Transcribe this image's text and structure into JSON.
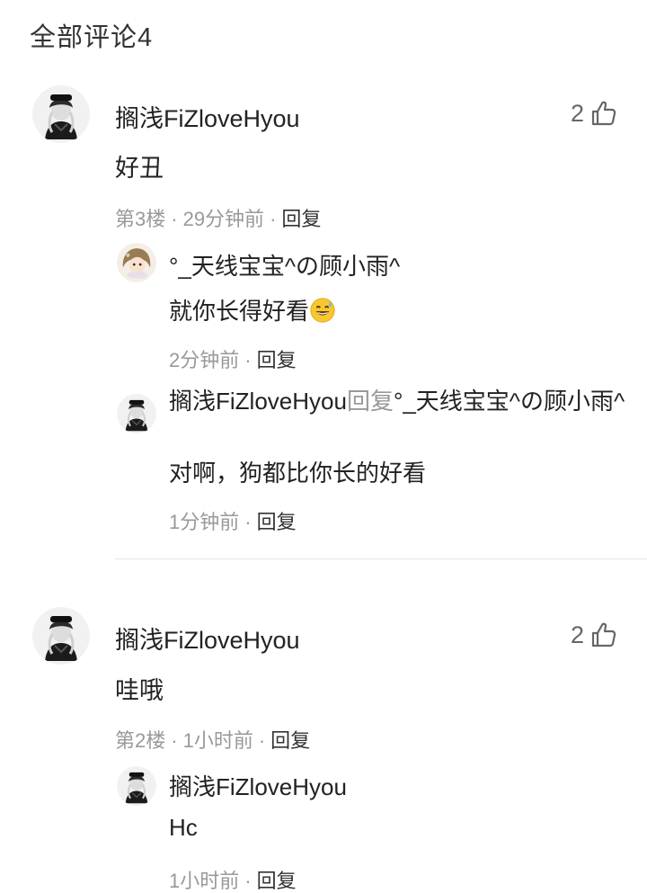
{
  "header": {
    "title": "全部评论4"
  },
  "comments": [
    {
      "user": "搁浅FiZloveHyou",
      "text": "好丑",
      "floor": "第3楼",
      "time": "29分钟前",
      "reply_label": "回复",
      "likes": "2",
      "replies": [
        {
          "user": "°_天线宝宝^の顾小雨^",
          "text": "就你长得好看",
          "emoji": "sweat-smile-emoji",
          "time": "2分钟前",
          "reply_label": "回复"
        },
        {
          "user": "搁浅FiZloveHyou",
          "reply_word": "回复",
          "target": "°_天线宝宝^の顾小雨^",
          "text": "对啊，狗都比你长的好看",
          "time": "1分钟前",
          "reply_label": "回复"
        }
      ]
    },
    {
      "user": "搁浅FiZloveHyou",
      "text": "哇哦",
      "floor": "第2楼",
      "time": "1小时前",
      "reply_label": "回复",
      "likes": "2",
      "replies": [
        {
          "user": "搁浅FiZloveHyou",
          "text": "Hc",
          "time": "1小时前",
          "reply_label": "回复"
        }
      ]
    }
  ],
  "meta_separator": "·",
  "icons": {
    "like": "thumbs-up-icon",
    "avatar_main": "anime-avatar-dark",
    "avatar_girl": "anime-avatar-girl"
  }
}
